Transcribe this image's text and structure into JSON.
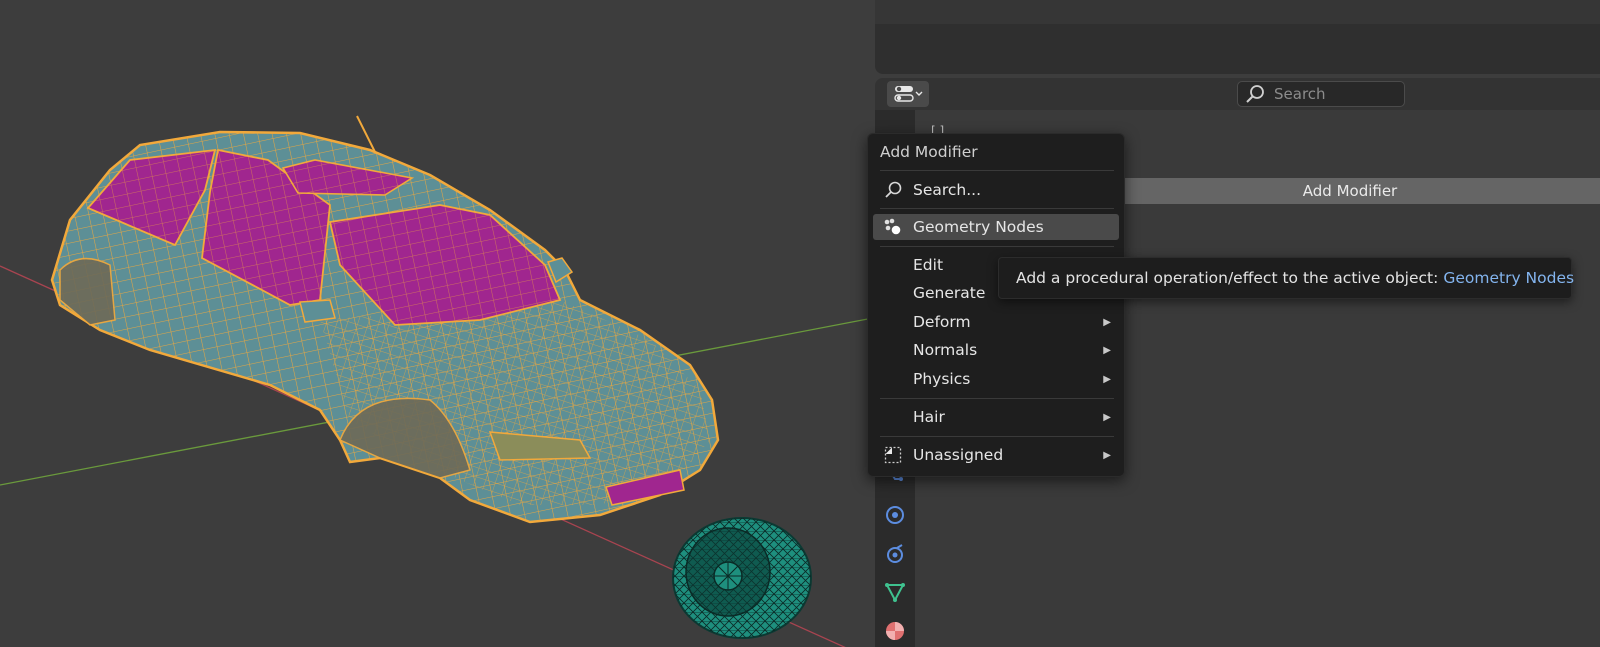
{
  "viewport": {
    "scene_objects": [
      "car-mesh",
      "wheel-mesh"
    ]
  },
  "properties": {
    "header": {
      "search_placeholder": "Search",
      "editor_type_icon": "properties-editor-icon"
    },
    "add_modifier_button": "Add Modifier",
    "tabs": [
      "physics-icon",
      "constraints-icon",
      "particles-icon",
      "data-icon",
      "material-icon"
    ]
  },
  "menu": {
    "title": "Add Modifier",
    "items": [
      {
        "label": "Search...",
        "icon": "search-icon",
        "submenu": false
      },
      {
        "label": "Geometry Nodes",
        "icon": "geometry-nodes-icon",
        "submenu": false,
        "active": true
      },
      {
        "label": "Edit",
        "submenu": true
      },
      {
        "label": "Generate",
        "submenu": true
      },
      {
        "label": "Deform",
        "submenu": true
      },
      {
        "label": "Normals",
        "submenu": true
      },
      {
        "label": "Physics",
        "submenu": true
      },
      {
        "label": "Hair",
        "submenu": true
      },
      {
        "label": "Unassigned",
        "icon": "asset-icon",
        "submenu": true
      }
    ],
    "arrow": "▶"
  },
  "tooltip": {
    "text": "Add a procedural operation/effect to the active object:",
    "highlight": "Geometry Nodes"
  },
  "colors": {
    "wire": "#f2a93b",
    "glass": "#a0268f",
    "body": "#5d8f96",
    "wheel": "#1e8f7e",
    "axis_x": "#a84450",
    "axis_y": "#6a9a3c",
    "tooltip_highlight": "#83b4ee"
  }
}
